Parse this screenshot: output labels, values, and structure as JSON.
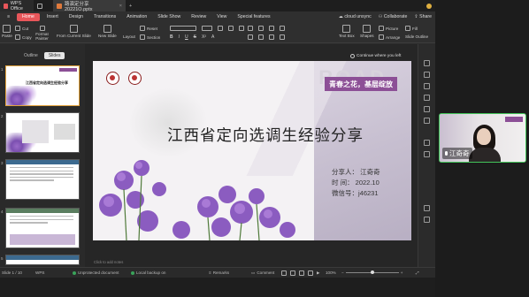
{
  "titlebar": {
    "app_tab": "WPS Office",
    "file_tab": "路演定分享20221O.pptx"
  },
  "menu": {
    "items": [
      "Home",
      "Insert",
      "Design",
      "Transitions",
      "Animation",
      "Slide Show",
      "Review",
      "View",
      "Special features"
    ],
    "right": [
      "cloud unsync",
      "Collaborate",
      "Share"
    ]
  },
  "toolbar": {
    "paste": "Paste",
    "cut": "Cut",
    "copy": "Copy",
    "format_painter": "Format Painter",
    "from_current_slide": "From Current Slide",
    "new_slide": "New Slide",
    "layout": "Layout",
    "reset": "Reset",
    "section": "Section",
    "text_box": "Text Box",
    "shapes": "Shapes",
    "arrange": "Arrange",
    "picture": "Picture",
    "fill": "Fill",
    "outline": "Outline",
    "slide_outline": "Slide Outline"
  },
  "leftpane": {
    "tabs": [
      "Outline",
      "Slides"
    ],
    "thumb1_title": "江西省定向选调生经验分享"
  },
  "slide": {
    "watermark": "ROAD",
    "banner": "青春之花，基层绽放",
    "title": "江西省定向选调生经验分享",
    "info": [
      "分享人：  江奇奇",
      "时    间：  2022.10",
      "微信号：j46231"
    ]
  },
  "continue_label": "Continue where you left",
  "notes_placeholder": "Click to add notes",
  "status": {
    "slide_count": "Slide 1 / 10",
    "theme": "WPS",
    "protected": "Unprotected document",
    "backup": "Local backup on",
    "remarks": "Remarks",
    "comment": "Comment",
    "zoom": "100%"
  },
  "call": {
    "participant_name": "江奇奇"
  },
  "colors": {
    "accent": "#e8565a",
    "banner": "#8c4f96",
    "video_border": "#43c55a"
  }
}
